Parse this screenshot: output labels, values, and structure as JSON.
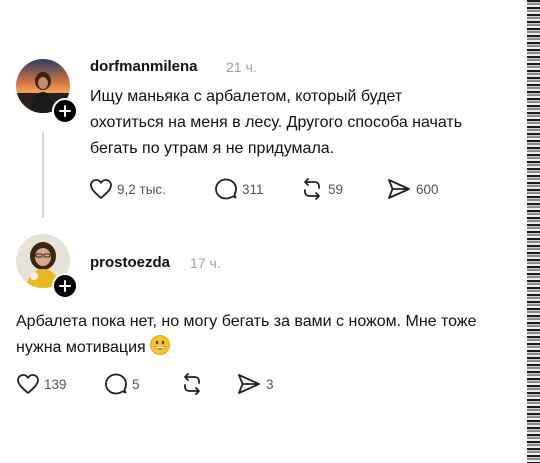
{
  "comments": [
    {
      "username": "dorfmanmilena",
      "time": "21 ч.",
      "text": "Ищу маньяка с арбалетом, который будет охотиться на меня в лесу. Другого способа начать бегать по утрам я не придумала.",
      "actions": {
        "likes": "9,2 тыс.",
        "replies": "311",
        "reposts": "59",
        "shares": "600"
      }
    },
    {
      "username": "prostoezda",
      "time": "17 ч.",
      "text": "Арбалета пока нет, но могу бегать за вами с ножом. Мне тоже нужна мотивация",
      "emoji": "grinning-face-emoji",
      "actions": {
        "likes": "139",
        "replies": "5",
        "reposts": "",
        "shares": "3"
      }
    }
  ],
  "icons": {
    "like": "heart-icon",
    "reply": "comment-bubble-icon",
    "repost": "repost-arrows-icon",
    "share": "send-arrow-icon",
    "follow": "plus-icon"
  },
  "colors": {
    "text": "#111111",
    "muted": "#a0a0a0",
    "action": "#555555",
    "badge": "#000000",
    "thread_line": "#d4d4d4"
  }
}
